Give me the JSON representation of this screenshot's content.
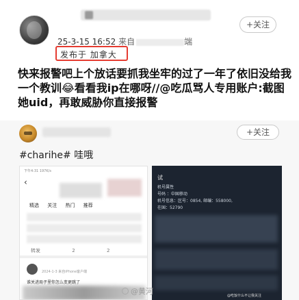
{
  "post": {
    "timestamp": "25-3-15 16:52",
    "source_label": "来自",
    "source_suffix": "端",
    "ip_location": "发布于 加拿大",
    "follow_label": "+关注",
    "text": "快来报警吧上个放话要抓我坐牢的过了一年了依旧没给我一个教训😂看看我ip在哪呀//@吃瓜骂人专用账户:截图她uid，再敢威胁你直接报警"
  },
  "repost": {
    "follow_label": "+关注",
    "hashtag": "#charihe#",
    "hashtag_text": "哇哦",
    "left_image": {
      "status_text": "下午4:31 197K/s",
      "back_glyph": "‹",
      "tabs": [
        "精选",
        "关注",
        "热门",
        "推荐"
      ],
      "counts": [
        "转发",
        "2",
        "2"
      ],
      "date_text": "2024-1-3 来自iPhone客户端",
      "comment_text": "谁关进局子里你怎么变更跳了"
    },
    "right_image": {
      "header": "试",
      "lines": [
        "机号属性",
        "号码     ：中国移动",
        "机号信息：区号：0854, 邮编：558000,",
        "在国：52790"
      ],
      "watermark": "@吃饭什么不让我关注"
    },
    "caption": "@黄河"
  },
  "colors": {
    "highlight_border": "#e53b30",
    "text_dark": "#111111",
    "muted": "#9a9a9a"
  },
  "icons": {
    "back": "chevron-left-icon",
    "watermark": "weibo-icon"
  }
}
